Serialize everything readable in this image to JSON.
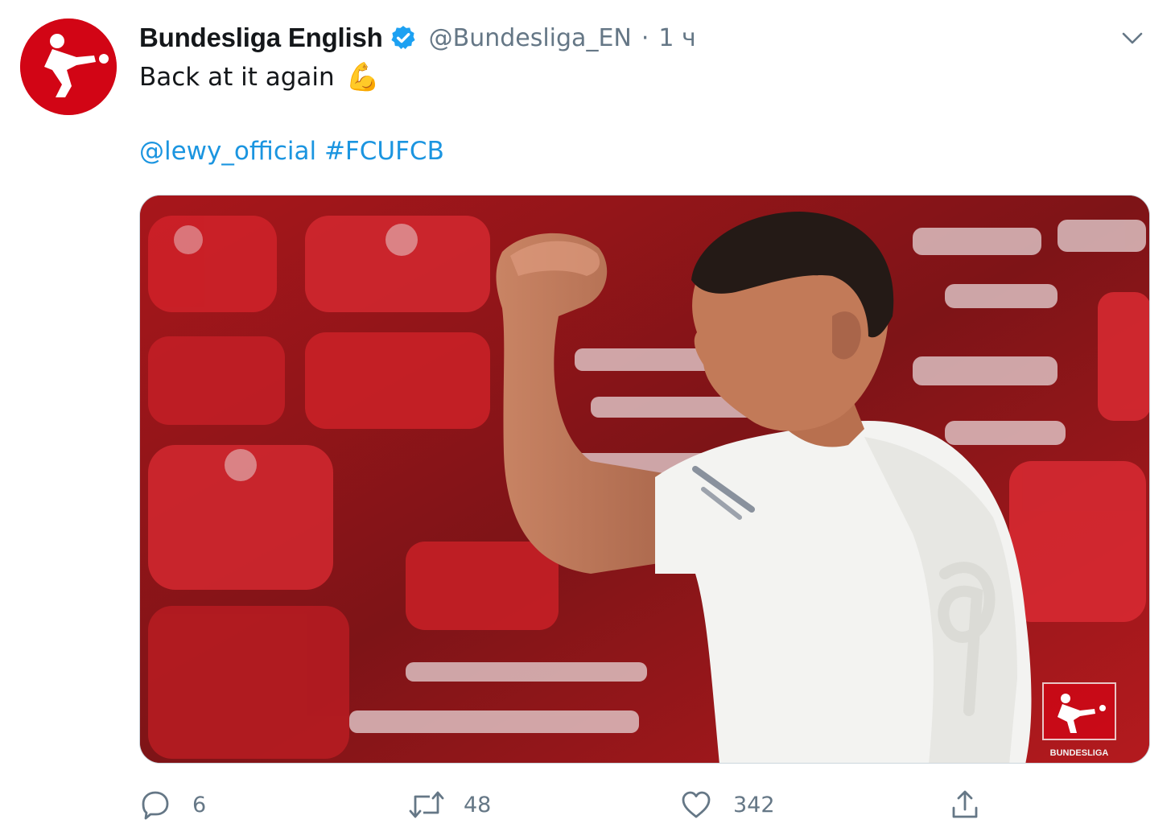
{
  "tweet": {
    "author_name": "Bundesliga English",
    "handle": "@Bundesliga_EN",
    "separator": "·",
    "time": "1 ч",
    "text": "Back at it again",
    "emoji": "💪",
    "mention": "@lewy_official",
    "hashtag": "#FCUFCB",
    "media_watermark": "BUNDESLIGA"
  },
  "actions": {
    "reply_count": "6",
    "retweet_count": "48",
    "like_count": "342"
  },
  "colors": {
    "brand_red": "#d20515",
    "link_blue": "#1b95e0",
    "muted_gray": "#657786"
  },
  "icons": {
    "verified": "verified-badge-icon",
    "more": "chevron-down-icon",
    "reply": "reply-bubble-icon",
    "retweet": "retweet-arrows-icon",
    "like": "heart-outline-icon",
    "share": "share-upload-icon"
  }
}
